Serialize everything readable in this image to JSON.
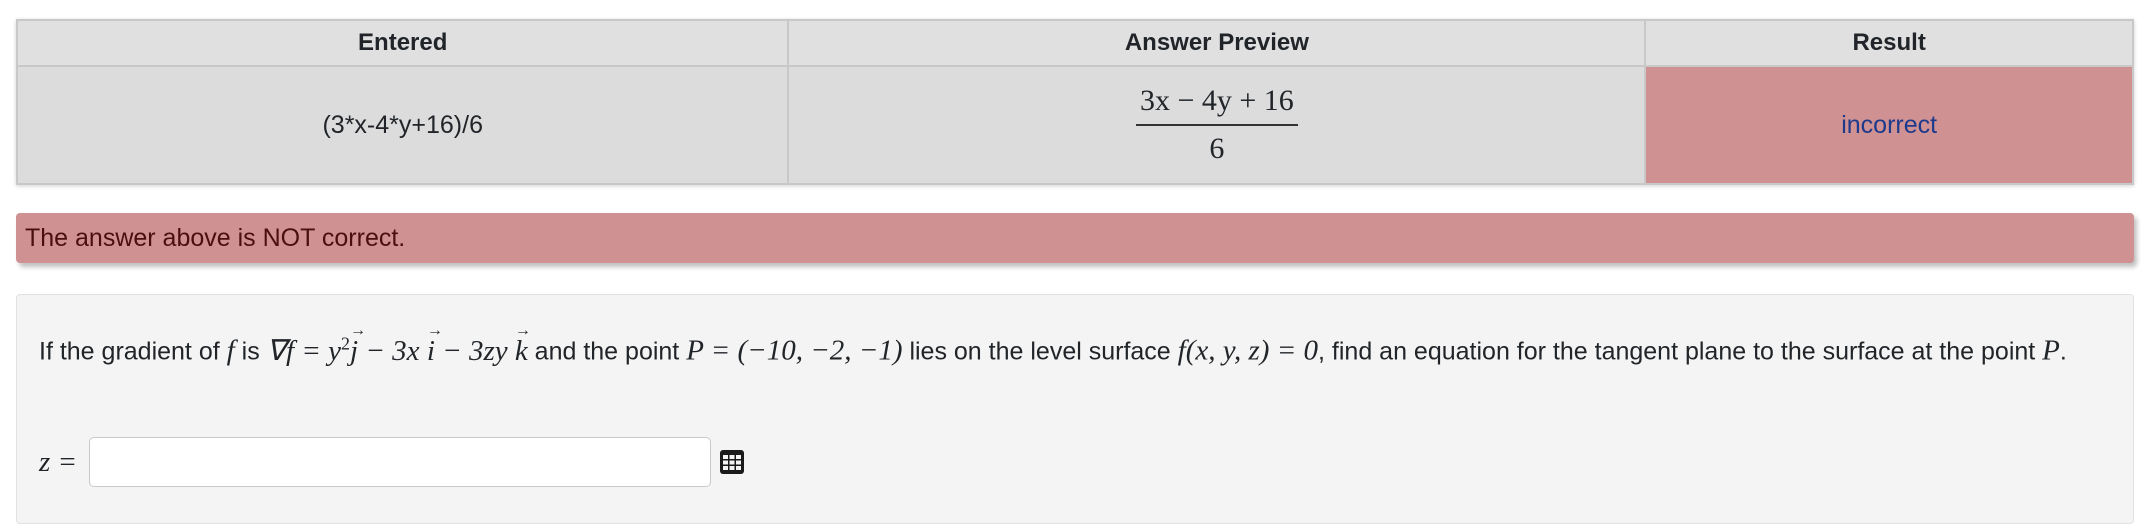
{
  "results_table": {
    "headers": [
      "Entered",
      "Answer Preview",
      "Result"
    ],
    "row": {
      "entered": "(3*x-4*y+16)/6",
      "preview_numerator": "3x − 4y + 16",
      "preview_denominator": "6",
      "result": "incorrect"
    }
  },
  "alert": {
    "message": "The answer above is NOT correct."
  },
  "problem": {
    "text_1": "If the gradient of ",
    "f": "f",
    "text_2": " is ",
    "gradient_lhs": "∇f = y",
    "exp2": "2",
    "j": "j",
    "minus_3x": " − 3x ",
    "i": "i",
    "minus_3zy": " − 3zy ",
    "k": "k",
    "text_3": " and the point ",
    "point": "P = (−10, −2, −1)",
    "text_4": " lies on the level surface ",
    "surface": "f(x, y, z) = 0",
    "text_5": ", find an equation for the tangent plane to the surface at the point ",
    "P": "P",
    "text_6": "."
  },
  "answer": {
    "label": "z =",
    "value": "",
    "placeholder": ""
  },
  "colors": {
    "incorrect_bg": "#cf9191",
    "incorrect_text": "#1e3a8c",
    "alert_text": "#4a1010"
  },
  "icons": {
    "equation_editor": "grid-icon"
  }
}
